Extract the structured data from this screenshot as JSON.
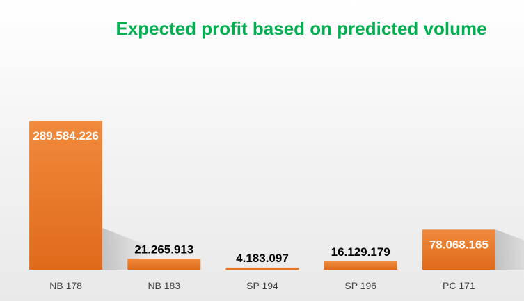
{
  "chart_data": {
    "type": "bar",
    "title": "Expected profit based on predicted volume",
    "categories": [
      "NB 178",
      "NB 183",
      "SP 194",
      "SP 196",
      "PC 171"
    ],
    "values": [
      289584226,
      21265913,
      4183097,
      16129179,
      78068165
    ],
    "value_labels": [
      "289.584.226",
      "21.265.913",
      "4.183.097",
      "16.129.179",
      "78.068.165"
    ],
    "ylim": [
      0,
      300000000
    ],
    "grid": false,
    "legend": "none",
    "colors": {
      "title": "#00b050",
      "bar_top": "#f08a3c",
      "bar_bottom": "#e06a1a",
      "label_inside": "#ffffff",
      "label_outside": "#000000"
    }
  }
}
